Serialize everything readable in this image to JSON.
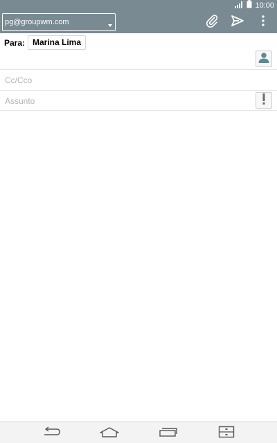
{
  "status_bar": {
    "time": "10:00",
    "icons": [
      "signal-icon",
      "battery-icon"
    ]
  },
  "toolbar": {
    "account": "pg@groupwm.com",
    "icons": [
      "attach-icon",
      "send-icon",
      "more-icon"
    ]
  },
  "compose": {
    "to_label": "Para:",
    "recipient": "Marina Lima",
    "cc_placeholder": "Cc/Cco",
    "subject_placeholder": "Assunto"
  },
  "navigation": {
    "icons": [
      "back-icon",
      "home-icon",
      "recent-apps-icon",
      "dual-window-icon"
    ]
  },
  "colors": {
    "toolbar": "#7a8a92",
    "placeholder": "#b4b4b4",
    "contact_icon": "#5e8a93"
  }
}
